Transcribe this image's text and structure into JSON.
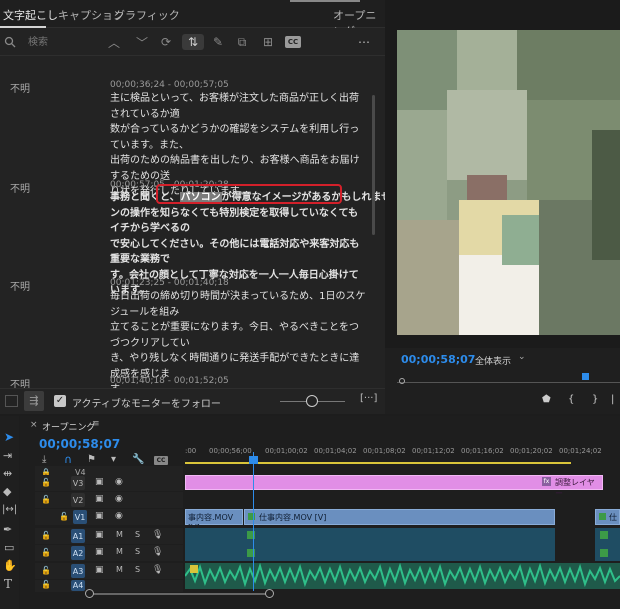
{
  "transcript_panel": {
    "tabs": [
      "文字起こし",
      "キャプション",
      "グラフィック"
    ],
    "sequence_tab": "オープニング",
    "search_placeholder": "検索",
    "segments": [
      {
        "speaker": "不明",
        "timecode": "00;00;36;24 - 00;00;57;05",
        "lines": [
          "主に検品といって、お客様が注文した商品が正しく出荷されているか適",
          "数が合っているかどうかの確認をシステムを利用し行っています。また、",
          "出荷のための納品書を出したり、お客様へ商品をお届けするための送",
          "り状を発行したりしています。"
        ]
      },
      {
        "speaker": "不明",
        "timecode": "00;00;57;05 - 00;01;20;28",
        "line1_pre": "事務と聞くと、",
        "line1_highlight": "パソコン",
        "line1_post": "が得意なイメージがあるかもしれませんが、パソコ",
        "lines": [
          "ンの操作を知らなくても特別検定を取得していなくてもイチから学べるの",
          "で安心してください。その他には電話対応や来客対応も重要な業務で",
          "す。会社の顔として丁寧な対応を一人一人毎日心掛けています。"
        ]
      },
      {
        "speaker": "不明",
        "timecode": "00;01;23;25 - 00;01;40;18",
        "lines": [
          "毎日出荷の締め切り時間が決まっているため、1日のスケジュールを組み",
          "立てることが重要になります。今日、やるべきことをつづつクリアしてい",
          "き、やり残しなく時間通りに発送手配ができたときに達成感を感じま",
          "す。"
        ]
      },
      {
        "speaker": "不明",
        "timecode": "00;01;40;18 - 00;01;52;05"
      }
    ],
    "follow_monitor_label": "アクティブなモニターをフォロー",
    "follow_monitor_checked": true
  },
  "program_monitor": {
    "timecode": "00;00;58;07",
    "zoom_label": "全体表示"
  },
  "timeline": {
    "sequence_name": "オープニング",
    "timecode": "00;00;58;07",
    "ruler_labels": [
      ":00",
      "00;00;56;00",
      "00;01;00;02",
      "00;01;04;02",
      "00;01;08;02",
      "00;01;12;02",
      "00;01;16;02",
      "00;01;20;02",
      "00;01;24;02"
    ],
    "tracks": [
      {
        "label": "V4",
        "kind": "video"
      },
      {
        "label": "V3",
        "kind": "video"
      },
      {
        "label": "V2",
        "kind": "video"
      },
      {
        "label": "V1",
        "kind": "video",
        "source": "V1"
      },
      {
        "label": "A1",
        "kind": "audio"
      },
      {
        "label": "A2",
        "kind": "audio"
      },
      {
        "label": "A3",
        "kind": "audio"
      },
      {
        "label": "A4",
        "kind": "audio"
      }
    ],
    "clips": {
      "adjustment_layer": "調整レイヤー",
      "v1_clip_a": "事内容.MOV [V]",
      "v1_clip_b": "仕事内容.MOV [V]",
      "v1_clip_c": "仕"
    }
  },
  "colors": {
    "accent_blue": "#2d8ceb",
    "highlight_red": "#d3202a",
    "adjustment_pink": "#e18ee6",
    "audio_green": "#2fc08a"
  }
}
